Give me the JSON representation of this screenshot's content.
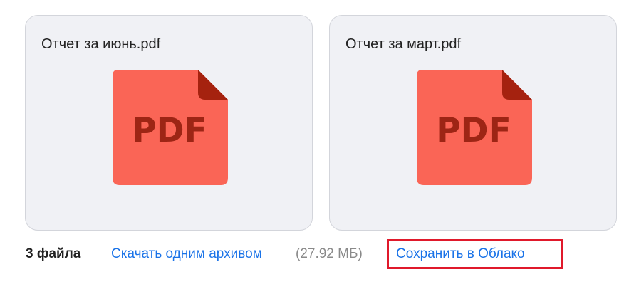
{
  "attachments": [
    {
      "title": "Отчет за июнь.pdf",
      "icon": "pdf-file-icon",
      "icon_label": "PDF"
    },
    {
      "title": "Отчет за март.pdf",
      "icon": "pdf-file-icon",
      "icon_label": "PDF"
    }
  ],
  "footer": {
    "file_count": "3 файла",
    "download_archive_label": "Скачать одним архивом",
    "archive_size": "(27.92 МБ)",
    "save_to_cloud_label": "Сохранить в Облако"
  },
  "colors": {
    "pdf_body": "#fa6556",
    "pdf_fold": "#a5220f",
    "pdf_text": "#9d2515",
    "link": "#1a73e8",
    "highlight_box": "#e0192b",
    "card_background": "#f0f1f5"
  }
}
